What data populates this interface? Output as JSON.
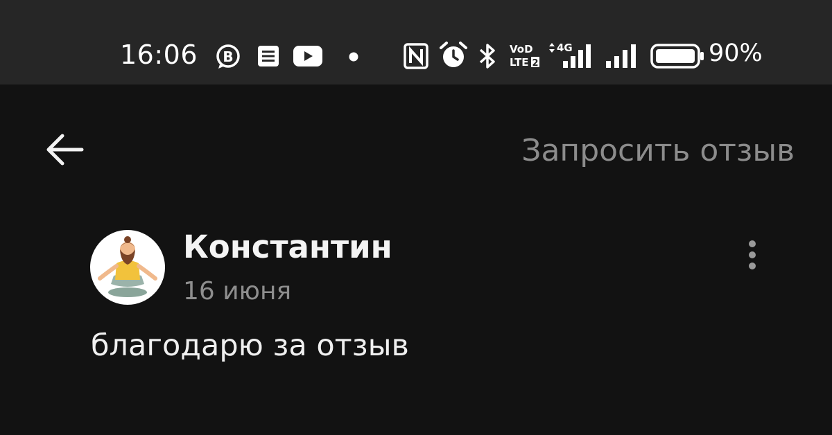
{
  "status_bar": {
    "time": "16:06",
    "battery_percent": "90%",
    "battery_level": 0.9,
    "volte_label_top": "VoD",
    "volte_label_bottom": "LTE",
    "volte_sim": "2",
    "network_type": "4G",
    "icons": [
      "b-chat-icon",
      "notes-icon",
      "youtube-icon",
      "dot-icon",
      "nfc-icon",
      "alarm-icon",
      "bluetooth-icon",
      "volte-icon",
      "signal-4g-icon",
      "signal-icon",
      "battery-icon"
    ]
  },
  "app_bar": {
    "back_icon": "arrow-left-icon",
    "action_label": "Запросить отзыв"
  },
  "review": {
    "author_name": "Константин",
    "date": "16 июня",
    "avatar_icon": "meditating-man-avatar",
    "menu_icon": "more-vertical-icon",
    "text": "благодарю за отзыв"
  },
  "colors": {
    "status_bar_bg": "#262626",
    "page_bg": "#121212",
    "primary_text": "#f2f2f2",
    "secondary_text": "#8e8e8e",
    "action_text": "#8c8c8c"
  }
}
